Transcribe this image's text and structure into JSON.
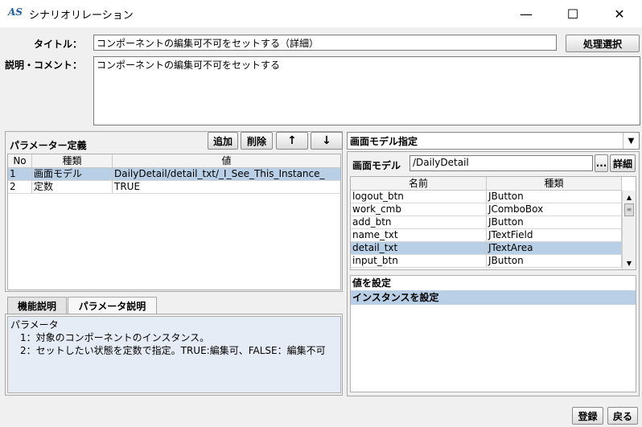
{
  "window": {
    "app_icon_text": "AS",
    "title": "シナリオリレーション",
    "minimize_glyph": "—",
    "maximize_glyph": "☐",
    "close_glyph": "✕"
  },
  "form": {
    "title_label": "タイトル：",
    "title_value": "コンポーネントの編集可不可をセットする（詳細）",
    "process_select_button": "処理選択",
    "comment_label": "説明・コメント：",
    "comment_value": "コンポーネントの編集可不可をセットする"
  },
  "params": {
    "heading": "パラメーター定義",
    "add_button": "追加",
    "delete_button": "削除",
    "up_button": "↑",
    "down_button": "↓",
    "columns": [
      "No",
      "種類",
      "値"
    ],
    "rows": [
      {
        "no": "1",
        "type": "画面モデル",
        "value": "DailyDetail/detail_txt/_I_See_This_Instance_",
        "selected": true
      },
      {
        "no": "2",
        "type": "定数",
        "value": "TRUE",
        "selected": false
      }
    ]
  },
  "tabs": {
    "items": [
      {
        "label": "機能説明",
        "active": false
      },
      {
        "label": "パラメータ説明",
        "active": true
      }
    ],
    "content_lines": [
      "パラメータ",
      "　1：対象のコンポーネントのインスタンス。",
      "　2：セットしたい状態を定数で指定。TRUE:編集可、FALSE：編集不可"
    ]
  },
  "model": {
    "dropdown_value": "画面モデル指定",
    "screen_model_label": "画面モデル",
    "screen_model_value": "/DailyDetail",
    "browse_button": "...",
    "detail_button": "詳細",
    "columns": [
      "名前",
      "種類"
    ],
    "rows": [
      {
        "name": "logout_btn",
        "type": "JButton",
        "selected": false
      },
      {
        "name": "work_cmb",
        "type": "JComboBox",
        "selected": false
      },
      {
        "name": "add_btn",
        "type": "JButton",
        "selected": false
      },
      {
        "name": "name_txt",
        "type": "JTextField",
        "selected": false
      },
      {
        "name": "detail_txt",
        "type": "JTextArea",
        "selected": true
      },
      {
        "name": "input_btn",
        "type": "JButton",
        "selected": false
      }
    ],
    "actions": [
      {
        "label": "値を設定",
        "selected": false
      },
      {
        "label": "インスタンスを設定",
        "selected": true
      }
    ]
  },
  "footer": {
    "register_button": "登録",
    "back_button": "戻る"
  }
}
